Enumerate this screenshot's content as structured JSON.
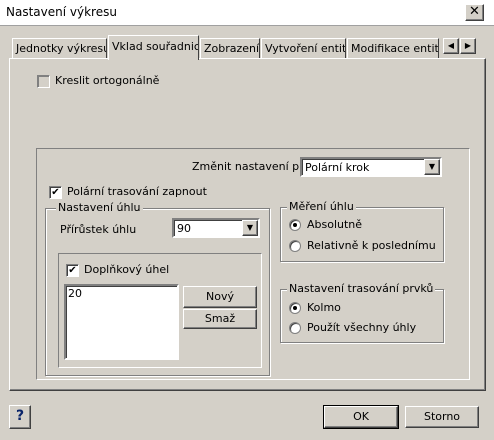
{
  "window": {
    "title": "Nastavení výkresu",
    "close_glyph": "✕"
  },
  "tabs": [
    {
      "label": "Jednotky výkresu:"
    },
    {
      "label": "Vklad souřadnic"
    },
    {
      "label": "Zobrazení"
    },
    {
      "label": "Vytvoření entity"
    },
    {
      "label": "Modifikace entity"
    }
  ],
  "tab_scroll": {
    "left": "◀",
    "right": "▶"
  },
  "ortho": {
    "label": "Kreslit ortogonálně",
    "checked": false
  },
  "change_settings": {
    "label": "Změnit nastavení pro:",
    "value": "Polární krok"
  },
  "polar_tracking": {
    "label": "Polární trasování zapnout",
    "checked": true
  },
  "angle_settings": {
    "legend": "Nastavení úhlu",
    "increment_label": "Přírůstek úhlu",
    "increment_value": "90",
    "additional_angle_label": "Doplňkový úhel",
    "additional_angle_checked": true,
    "angles": [
      "20"
    ],
    "new_button": "Nový",
    "delete_button": "Smaž"
  },
  "angle_measure": {
    "legend": "Měření úhlu",
    "options": [
      {
        "label": "Absolutně",
        "selected": true
      },
      {
        "label": "Relativně k poslednímu",
        "selected": false
      }
    ]
  },
  "object_tracking": {
    "legend": "Nastavení trasování prvků",
    "options": [
      {
        "label": "Kolmo",
        "selected": true
      },
      {
        "label": "Použít všechny úhly",
        "selected": false
      }
    ]
  },
  "footer": {
    "help": "?",
    "ok": "OK",
    "cancel": "Storno"
  },
  "glyphs": {
    "check": "✔",
    "dropdown": "▼"
  }
}
